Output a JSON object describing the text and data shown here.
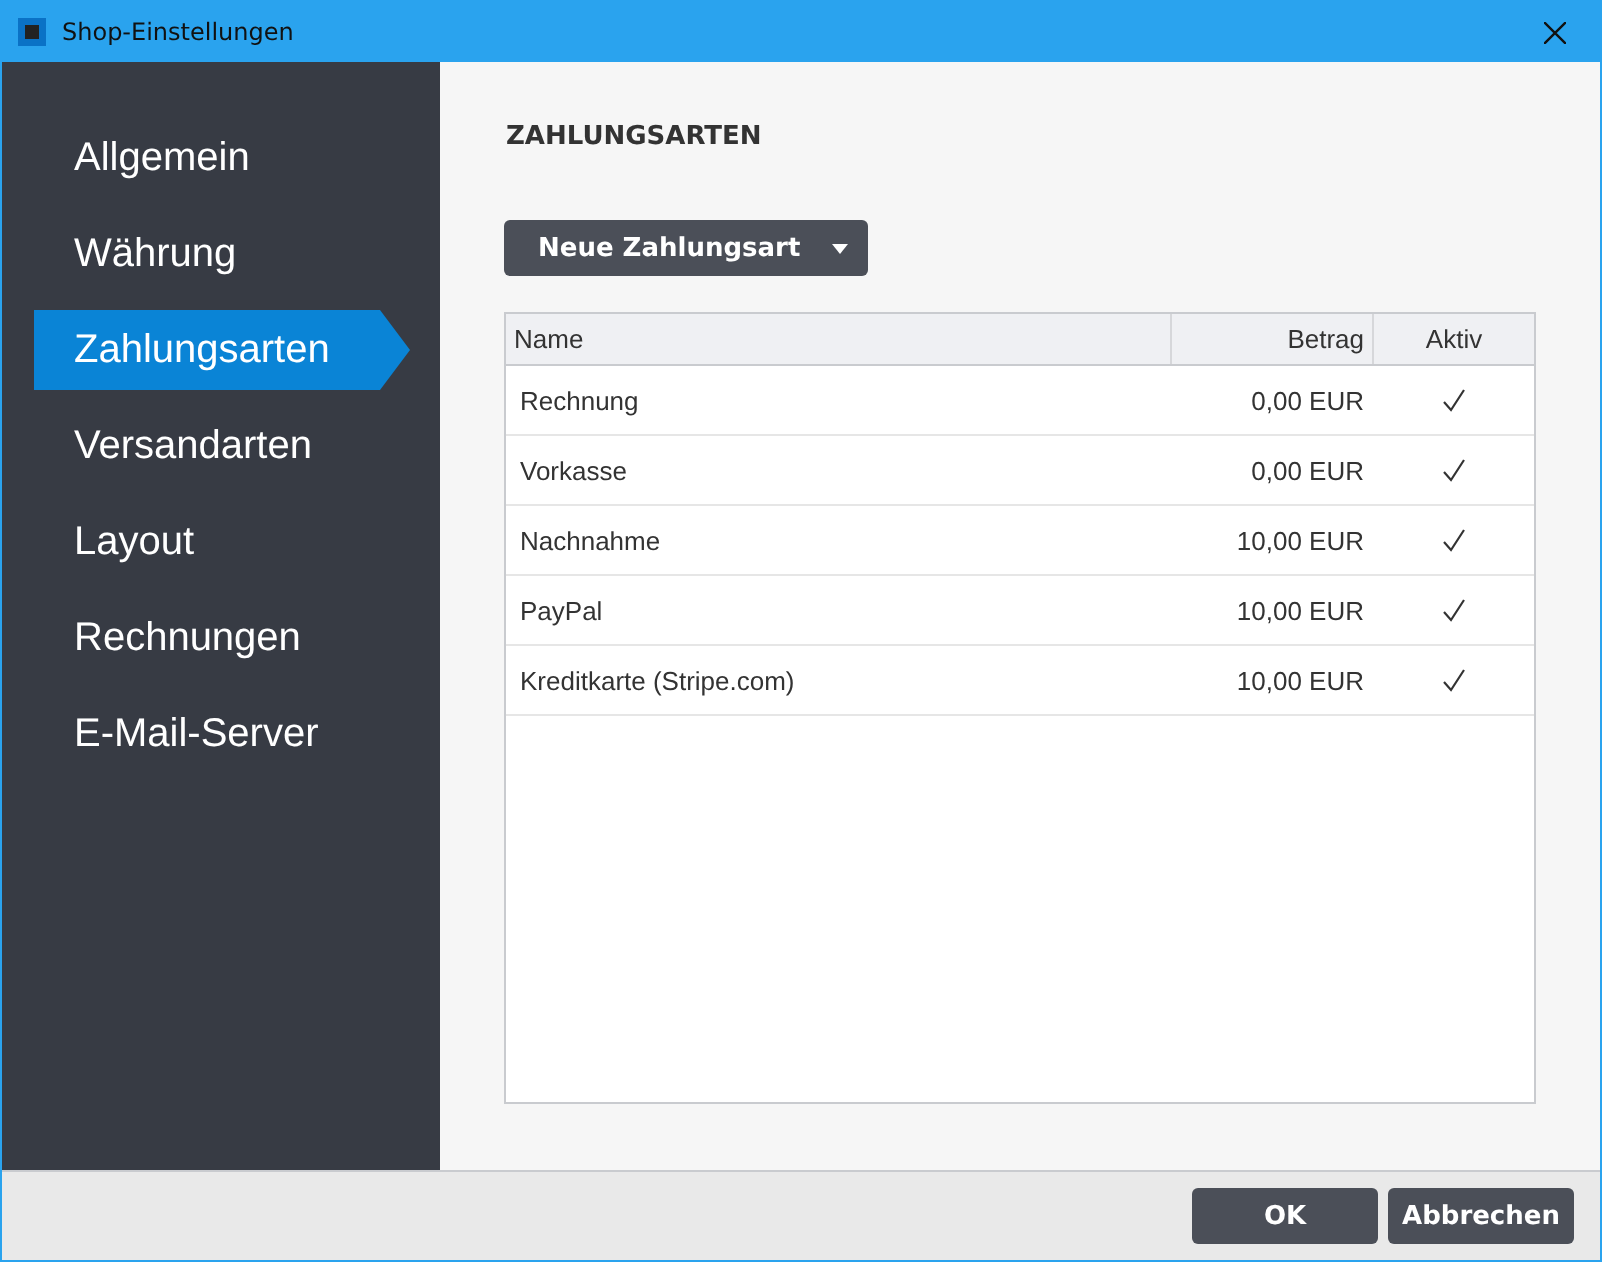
{
  "window": {
    "title": "Shop-Einstellungen"
  },
  "sidebar": {
    "items": [
      {
        "label": "Allgemein",
        "selected": false
      },
      {
        "label": "Währung",
        "selected": false
      },
      {
        "label": "Zahlungsarten",
        "selected": true
      },
      {
        "label": "Versandarten",
        "selected": false
      },
      {
        "label": "Layout",
        "selected": false
      },
      {
        "label": "Rechnungen",
        "selected": false
      },
      {
        "label": "E-Mail-Server",
        "selected": false
      }
    ]
  },
  "section_title": "ZAHLUNGSARTEN",
  "new_button": {
    "label": "Neue Zahlungsart"
  },
  "table": {
    "columns": [
      "Name",
      "Betrag",
      "Aktiv"
    ],
    "rows": [
      {
        "name": "Rechnung",
        "amount": "0,00 EUR",
        "active": true
      },
      {
        "name": "Vorkasse",
        "amount": "0,00 EUR",
        "active": true
      },
      {
        "name": "Nachnahme",
        "amount": "10,00 EUR",
        "active": true
      },
      {
        "name": "PayPal",
        "amount": "10,00 EUR",
        "active": true
      },
      {
        "name": "Kreditkarte (Stripe.com)",
        "amount": "10,00 EUR",
        "active": true
      }
    ]
  },
  "buttons": [
    "OK",
    "Abbrechen"
  ]
}
